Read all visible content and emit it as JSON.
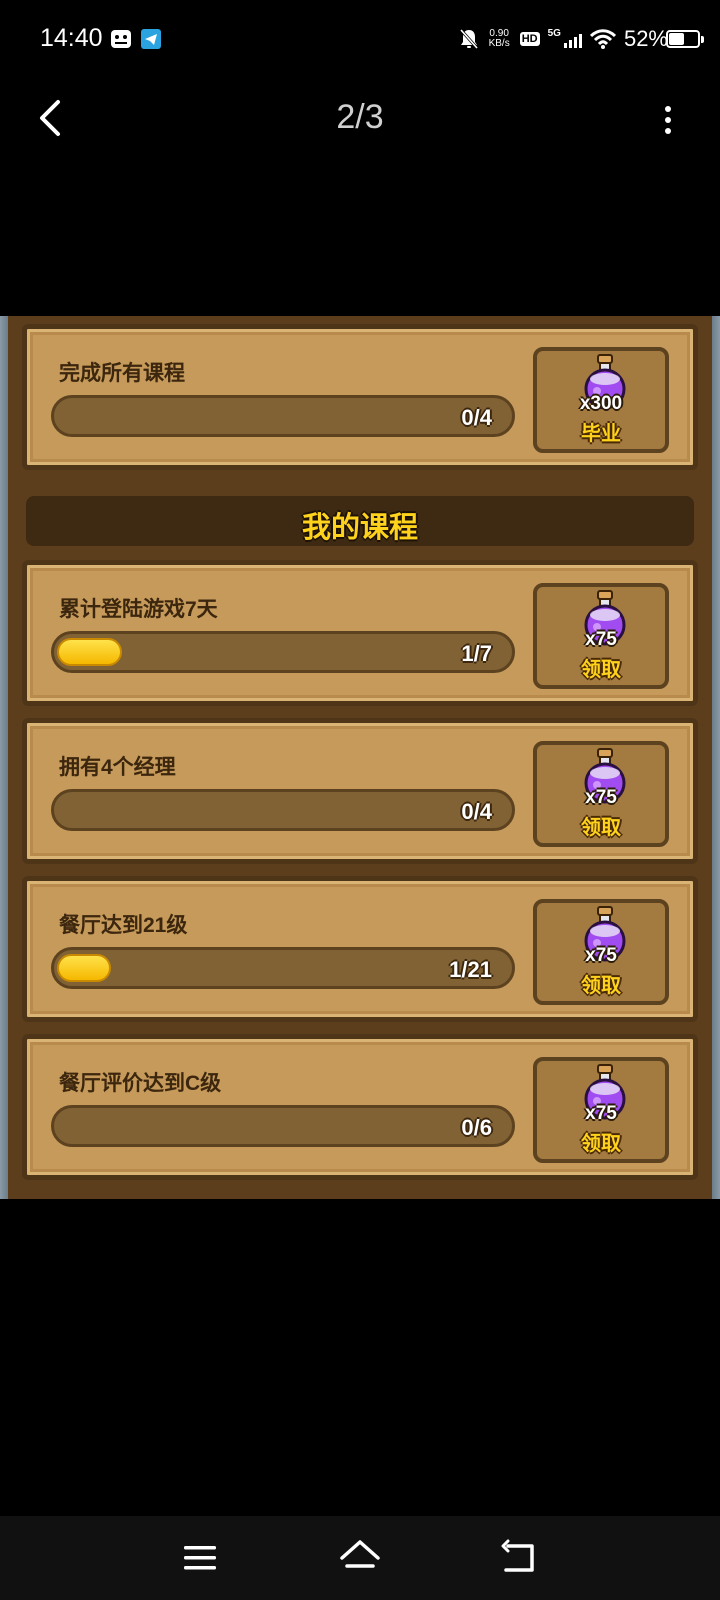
{
  "status_bar": {
    "time": "14:40",
    "net_speed_value": "0.90",
    "net_speed_unit": "KB/s",
    "hd": "HD",
    "network": "5G",
    "battery": "52%",
    "battery_level": 0.52,
    "icons": [
      "gallery-icon",
      "telegram-icon",
      "mute-icon",
      "signal-icon",
      "wifi-icon",
      "battery-icon"
    ]
  },
  "header": {
    "page_indicator": "2/3",
    "back_icon": "chevron-left-icon",
    "more_icon": "more-vertical-icon"
  },
  "game": {
    "graduation": {
      "title": "完成所有课程",
      "progress_text": "0/4",
      "progress": 0,
      "reward_count": "x300",
      "reward_label": "毕业"
    },
    "section_title": "我的课程",
    "courses": [
      {
        "title": "累计登陆游戏7天",
        "progress_text": "1/7",
        "progress": 0.142857,
        "reward_count": "x75",
        "reward_label": "领取"
      },
      {
        "title": "拥有4个经理",
        "progress_text": "0/4",
        "progress": 0,
        "reward_count": "x75",
        "reward_label": "领取"
      },
      {
        "title": "餐厅达到21级",
        "progress_text": "1/21",
        "progress": 0.047619,
        "reward_count": "x75",
        "reward_label": "领取"
      },
      {
        "title": "餐厅评价达到C级",
        "progress_text": "0/6",
        "progress": 0,
        "reward_count": "x75",
        "reward_label": "领取"
      }
    ]
  },
  "nav_bar": {
    "icons": [
      "menu-icon",
      "home-icon",
      "back-icon"
    ]
  },
  "colors": {
    "card_bg": "#c59a5a",
    "progress_fill": "#ffd21c",
    "potion": "#a04cf0",
    "label_yellow": "#ffd21c"
  }
}
